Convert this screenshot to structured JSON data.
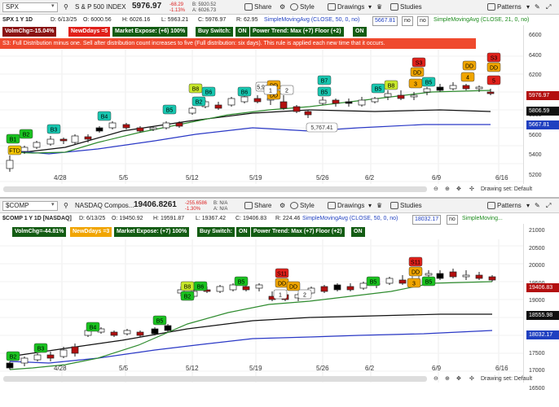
{
  "colors": {
    "up": "#ffffff",
    "down": "#b30f0f",
    "flat": "#000000",
    "sma50": "#111111",
    "sma21": "#2e8b2e",
    "sma200": "#3030c0",
    "note_bg": "#ef4a2e"
  },
  "top": {
    "symbol": "SPX",
    "name": "S & P 500 INDEX",
    "price": "5976.97",
    "chg_pts": "-68.29",
    "chg_pct": "-1.13%",
    "bid": "B: 5920.52",
    "ask": "A: 6026.73",
    "buttons": {
      "share": "Share",
      "drawings": "Drawings",
      "studies": "Studies",
      "patterns": "Patterns"
    },
    "study_row": {
      "label": "SPX 1 Y 1D",
      "date": "D: 6/13/25",
      "open": "O: 6000.56",
      "high": "H: 6026.16",
      "low": "L: 5963.21",
      "close": "C: 5976.97",
      "range": "R: 62.95",
      "sma50": "SimpleMovingAvg (CLOSE, 50, 0, no)",
      "sma50_val": "5667.81",
      "no1": "no",
      "no2": "no",
      "sma21": "SimpleMovingAvg (CLOSE, 21, 0, no)"
    },
    "tags": {
      "volm": "VolmChg=-15.04%",
      "newd": "NewDdays =5",
      "expose": "Market Expose: (+6) 100%",
      "switch": "Buy Switch:",
      "on1": "ON",
      "trend": "Power Trend: Max (+7) Floor (+2)",
      "on2": "ON"
    },
    "note": "S3: Full Distribution minus one. Sell after distribution count increases to five (Full distribution: six days). This rule is applied each new time that it occurs.",
    "axis": [
      "6600",
      "6400",
      "6200",
      "6000",
      "5800",
      "5600",
      "5400",
      "5200"
    ],
    "price_tags": [
      {
        "label": "5976.97",
        "color": "#b30f0f"
      },
      {
        "label": "5806.59",
        "color": "#111111"
      },
      {
        "label": "5667.81",
        "color": "#2040c0"
      }
    ],
    "dates": [
      "4/28",
      "5/5",
      "5/12",
      "5/19",
      "5/26",
      "6/2",
      "6/9",
      "6/16"
    ],
    "callout": "5,767.41",
    "drawing_set": "Drawing set: Default",
    "chart_data": {
      "type": "candlestick",
      "ylim": [
        5150,
        6700
      ],
      "series_names": [
        "SMA 50",
        "SMA 21"
      ]
    }
  },
  "bottom": {
    "symbol": "$COMP",
    "name": "NASDAQ Compos...",
    "price": "19406.8261",
    "chg_pts": "-255.6586",
    "chg_pct": "-1.30%",
    "bid": "B: N/A",
    "ask": "A: N/A",
    "buttons": {
      "share": "Share",
      "drawings": "Drawings",
      "studies": "Studies",
      "patterns": "Patterns"
    },
    "study_row": {
      "label": "$COMP 1 Y 1D [NASDAQ]",
      "date": "D: 6/13/25",
      "open": "O: 19450.92",
      "high": "H: 19591.87",
      "low": "L: 19367.42",
      "close": "C: 19406.83",
      "range": "R: 224.46",
      "sma50": "SimpleMovingAvg (CLOSE, 50, 0, no)",
      "sma50_val": "18032.17",
      "no1": "no",
      "sma21": "SimpleMoving..."
    },
    "tags": {
      "volm": "VolmChg=-44.81%",
      "newd": "NewDdays =3",
      "expose": "Market Expose: (+7) 100%",
      "switch": "Buy Switch:",
      "on1": "ON",
      "trend": "Power Trend: Max (+7) Floor (+2)",
      "on2": "ON"
    },
    "axis": [
      "21000",
      "20500",
      "20000",
      "19500",
      "19000",
      "18500",
      "18000",
      "17500",
      "17000",
      "16500"
    ],
    "price_tags": [
      {
        "label": "19406.83",
        "color": "#b30f0f"
      },
      {
        "label": "18555.98",
        "color": "#111111"
      },
      {
        "label": "18032.17",
        "color": "#2040c0"
      }
    ],
    "dates": [
      "4/28",
      "5/5",
      "5/12",
      "5/19",
      "5/26",
      "6/2",
      "6/9",
      "6/16"
    ],
    "drawing_set": "Drawing set: Default",
    "chart_data": {
      "type": "candlestick",
      "ylim": [
        16400,
        21300
      ],
      "series_names": [
        "SMA 50",
        "SMA 21"
      ]
    }
  }
}
